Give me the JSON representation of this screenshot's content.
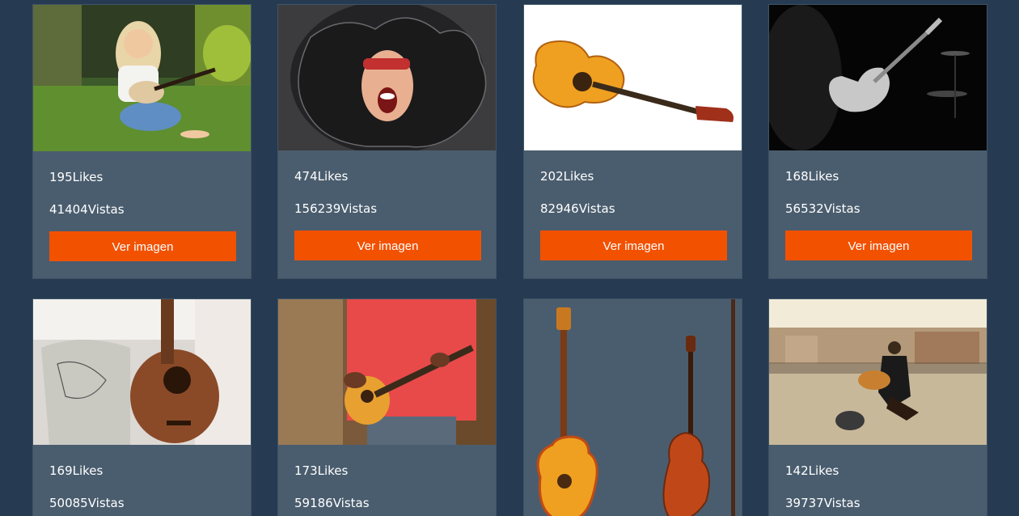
{
  "colors": {
    "page_background": "#263b52",
    "card_background": "#4a5d6e",
    "button_background": "#f25100",
    "text": "#ffffff"
  },
  "cards": [
    {
      "likes": "195Likes",
      "views": "41404Vistas",
      "button": "Ver imagen",
      "image": "girl-playing-ukulele-in-grass"
    },
    {
      "likes": "474Likes",
      "views": "156239Vistas",
      "button": "Ver imagen",
      "image": "rocker-with-wild-hair-shouting"
    },
    {
      "likes": "202Likes",
      "views": "82946Vistas",
      "button": "Ver imagen",
      "image": "classical-guitar-on-white"
    },
    {
      "likes": "168Likes",
      "views": "56532Vistas",
      "button": "Ver imagen",
      "image": "electric-guitarist-on-dark-stage"
    },
    {
      "likes": "169Likes",
      "views": "50085Vistas",
      "button": "Ver imagen",
      "image": "acoustic-guitar-on-sofa"
    },
    {
      "likes": "173Likes",
      "views": "59186Vistas",
      "button": "Ver imagen",
      "image": "man-in-red-shirt-playing-guitar"
    },
    {
      "likes": "",
      "views": "",
      "button": "",
      "image": "guitar-and-violin-illustration"
    },
    {
      "likes": "142Likes",
      "views": "39737Vistas",
      "button": "Ver imagen",
      "image": "street-guitarist-in-town-square"
    }
  ]
}
